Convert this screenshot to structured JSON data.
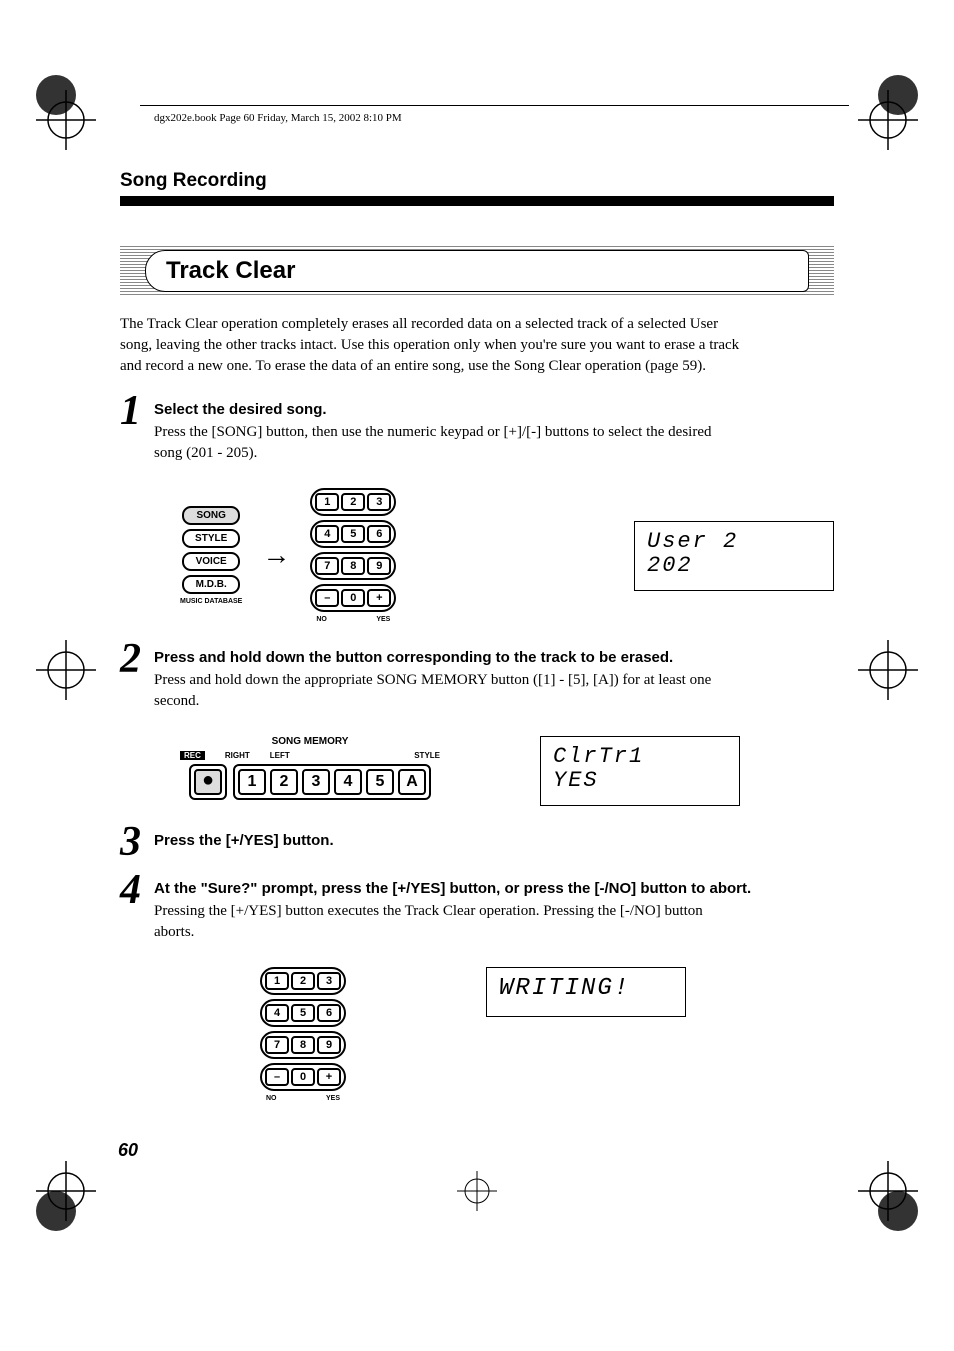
{
  "header_path": "dgx202e.book  Page 60  Friday, March 15, 2002  8:10 PM",
  "section_header": "Song Recording",
  "title": "Track Clear",
  "intro": "The Track Clear operation completely erases all recorded data on a selected track of a selected User song, leaving the other tracks intact.  Use this operation only when you're sure you want to erase a track and record a new one.  To erase the data of an entire song, use the Song Clear operation (page 59).",
  "steps": [
    {
      "num": "1",
      "title": "Select the desired song.",
      "body": "Press the [SONG] button, then use the numeric keypad or [+]/[-] buttons to select the desired song (201 - 205)."
    },
    {
      "num": "2",
      "title": "Press and hold down the button corresponding to the track to be erased.",
      "body": "Press and hold down the appropriate SONG MEMORY button ([1] - [5], [A]) for at least one second."
    },
    {
      "num": "3",
      "title": "Press the [+/YES] button.",
      "body": ""
    },
    {
      "num": "4",
      "title": "At the \"Sure?\" prompt, press the [+/YES] button, or press the [-/NO] button to abort.",
      "body": "Pressing the [+/YES] button executes the Track Clear operation. Pressing the [-/NO] button aborts."
    }
  ],
  "mode_buttons": {
    "song": "SONG",
    "style": "STYLE",
    "voice": "VOICE",
    "mdb": "M.D.B.",
    "mdb_sub": "MUSIC DATABASE"
  },
  "keypad": {
    "keys": [
      "1",
      "2",
      "3",
      "4",
      "5",
      "6",
      "7",
      "8",
      "9",
      "–",
      "0",
      "+"
    ],
    "no": "NO",
    "yes": "YES"
  },
  "lcd1": {
    "line1": "User 2",
    "line2": "202"
  },
  "song_memory": {
    "title": "SONG MEMORY",
    "labels": {
      "rec": "REC",
      "right": "RIGHT",
      "left": "LEFT",
      "style": "STYLE"
    },
    "rec": "●",
    "tracks": [
      "1",
      "2",
      "3",
      "4",
      "5",
      "A"
    ]
  },
  "lcd2": {
    "line1": "ClrTr1",
    "line2": "YES"
  },
  "lcd3": {
    "line1": "WRITING!"
  },
  "page_num": "60"
}
